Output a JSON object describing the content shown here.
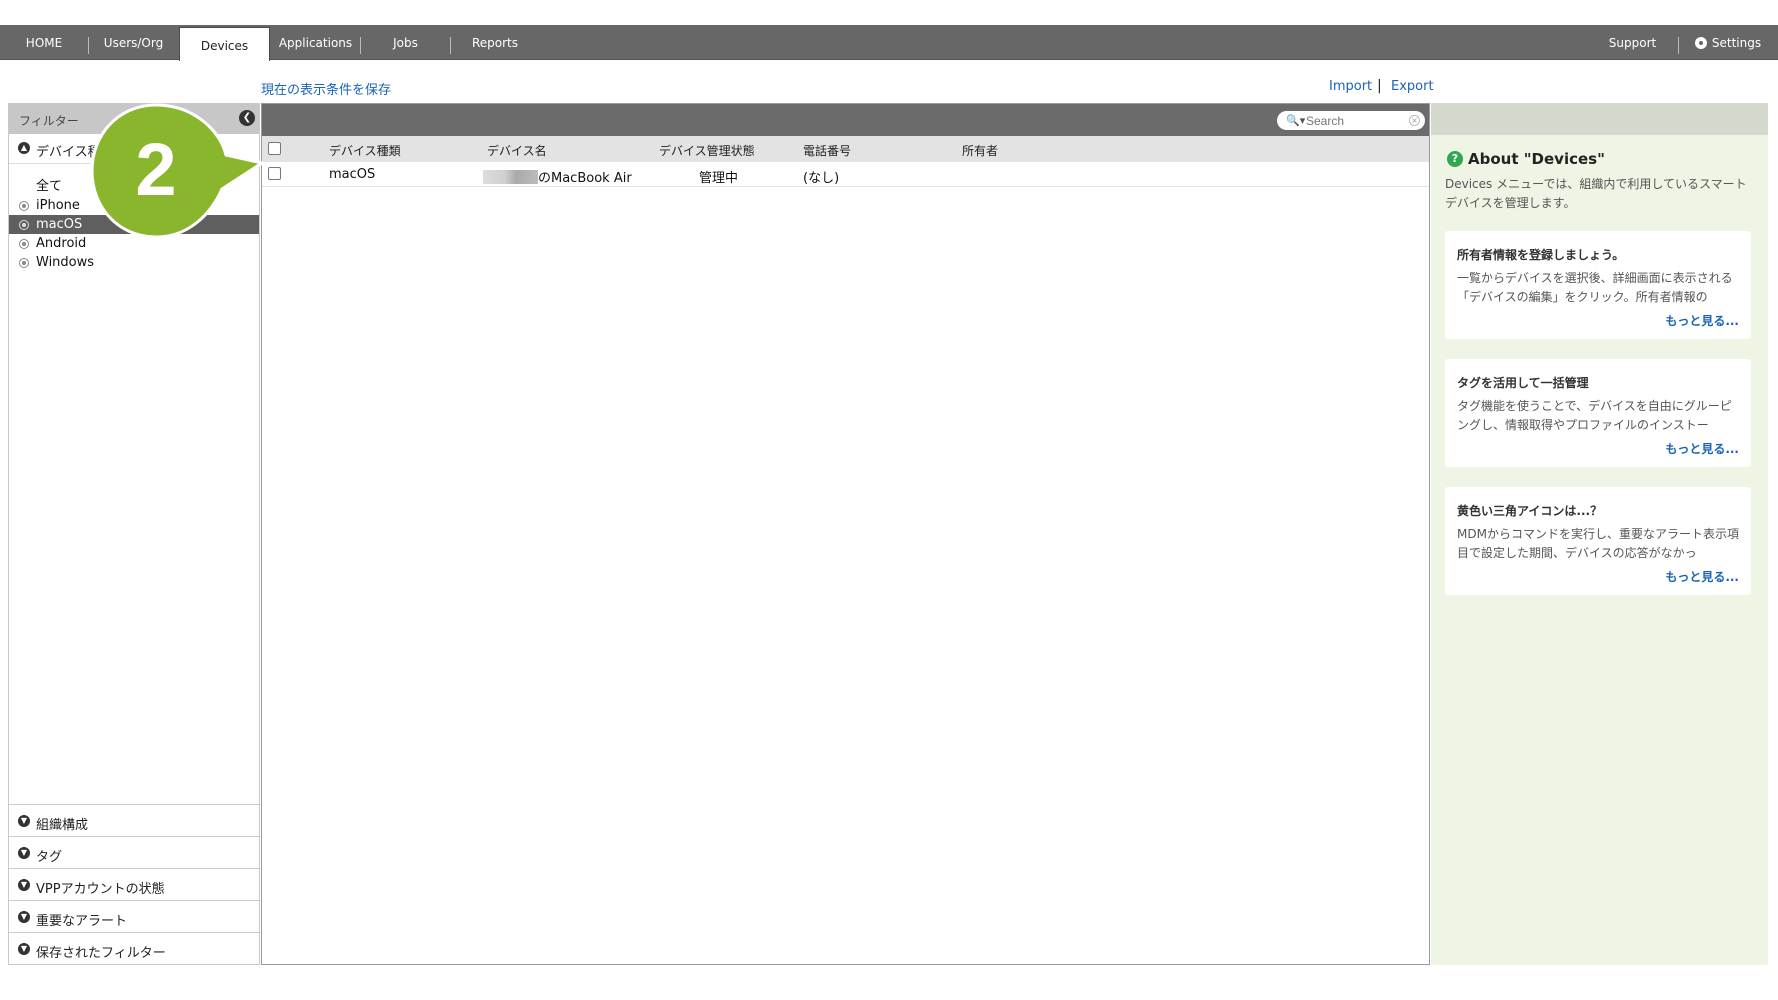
{
  "nav": {
    "tabs": [
      {
        "label": "HOME"
      },
      {
        "label": "Users/Org"
      },
      {
        "label": "Devices",
        "active": true
      },
      {
        "label": "Applications"
      },
      {
        "label": "Jobs"
      },
      {
        "label": "Reports"
      }
    ],
    "support": "Support",
    "settings": "Settings"
  },
  "actions": {
    "save_view": "現在の表示条件を保存",
    "import": "Import",
    "sep": "|",
    "export": "Export"
  },
  "filter": {
    "title": "フィルター",
    "device_section": "デバイス種",
    "device_items": [
      {
        "label": "全て",
        "radio": false
      },
      {
        "label": "iPhone",
        "radio": true
      },
      {
        "label": "macOS",
        "radio": true,
        "selected": true
      },
      {
        "label": "Android",
        "radio": true
      },
      {
        "label": "Windows",
        "radio": true
      }
    ],
    "bottom_sections": [
      "組織構成",
      "タグ",
      "VPPアカウントの状態",
      "重要なアラート",
      "保存されたフィルター"
    ]
  },
  "table": {
    "search_placeholder": "Search",
    "columns": [
      "デバイス種類",
      "デバイス名",
      "デバイス管理状態",
      "電話番号",
      "所有者"
    ],
    "rows": [
      {
        "type": "macOS",
        "name": "のMacBook Air",
        "status": "管理中",
        "phone": "(なし)",
        "owner": ""
      }
    ]
  },
  "info": {
    "title": "About \"Devices\"",
    "description": "Devices メニューでは、組織内で利用しているスマートデバイスを管理します。",
    "cards": [
      {
        "title": "所有者情報を登録しましょう。",
        "body": "一覧からデバイスを選択後、詳細画面に表示される「デバイスの編集」をクリック。所有者情報の",
        "more": "もっと見る..."
      },
      {
        "title": "タグを活用して一括管理",
        "body": "タグ機能を使うことで、デバイスを自由にグルーピングし、情報取得やプロファイルのインストー",
        "more": "もっと見る..."
      },
      {
        "title": "黄色い三角アイコンは...？",
        "body": "MDMからコマンドを実行し、重要なアラート表示項目で設定した期間、デバイスの応答がなかっ",
        "more": "もっと見る..."
      }
    ]
  },
  "callout": {
    "number": "2",
    "color": "#8ab62e"
  }
}
